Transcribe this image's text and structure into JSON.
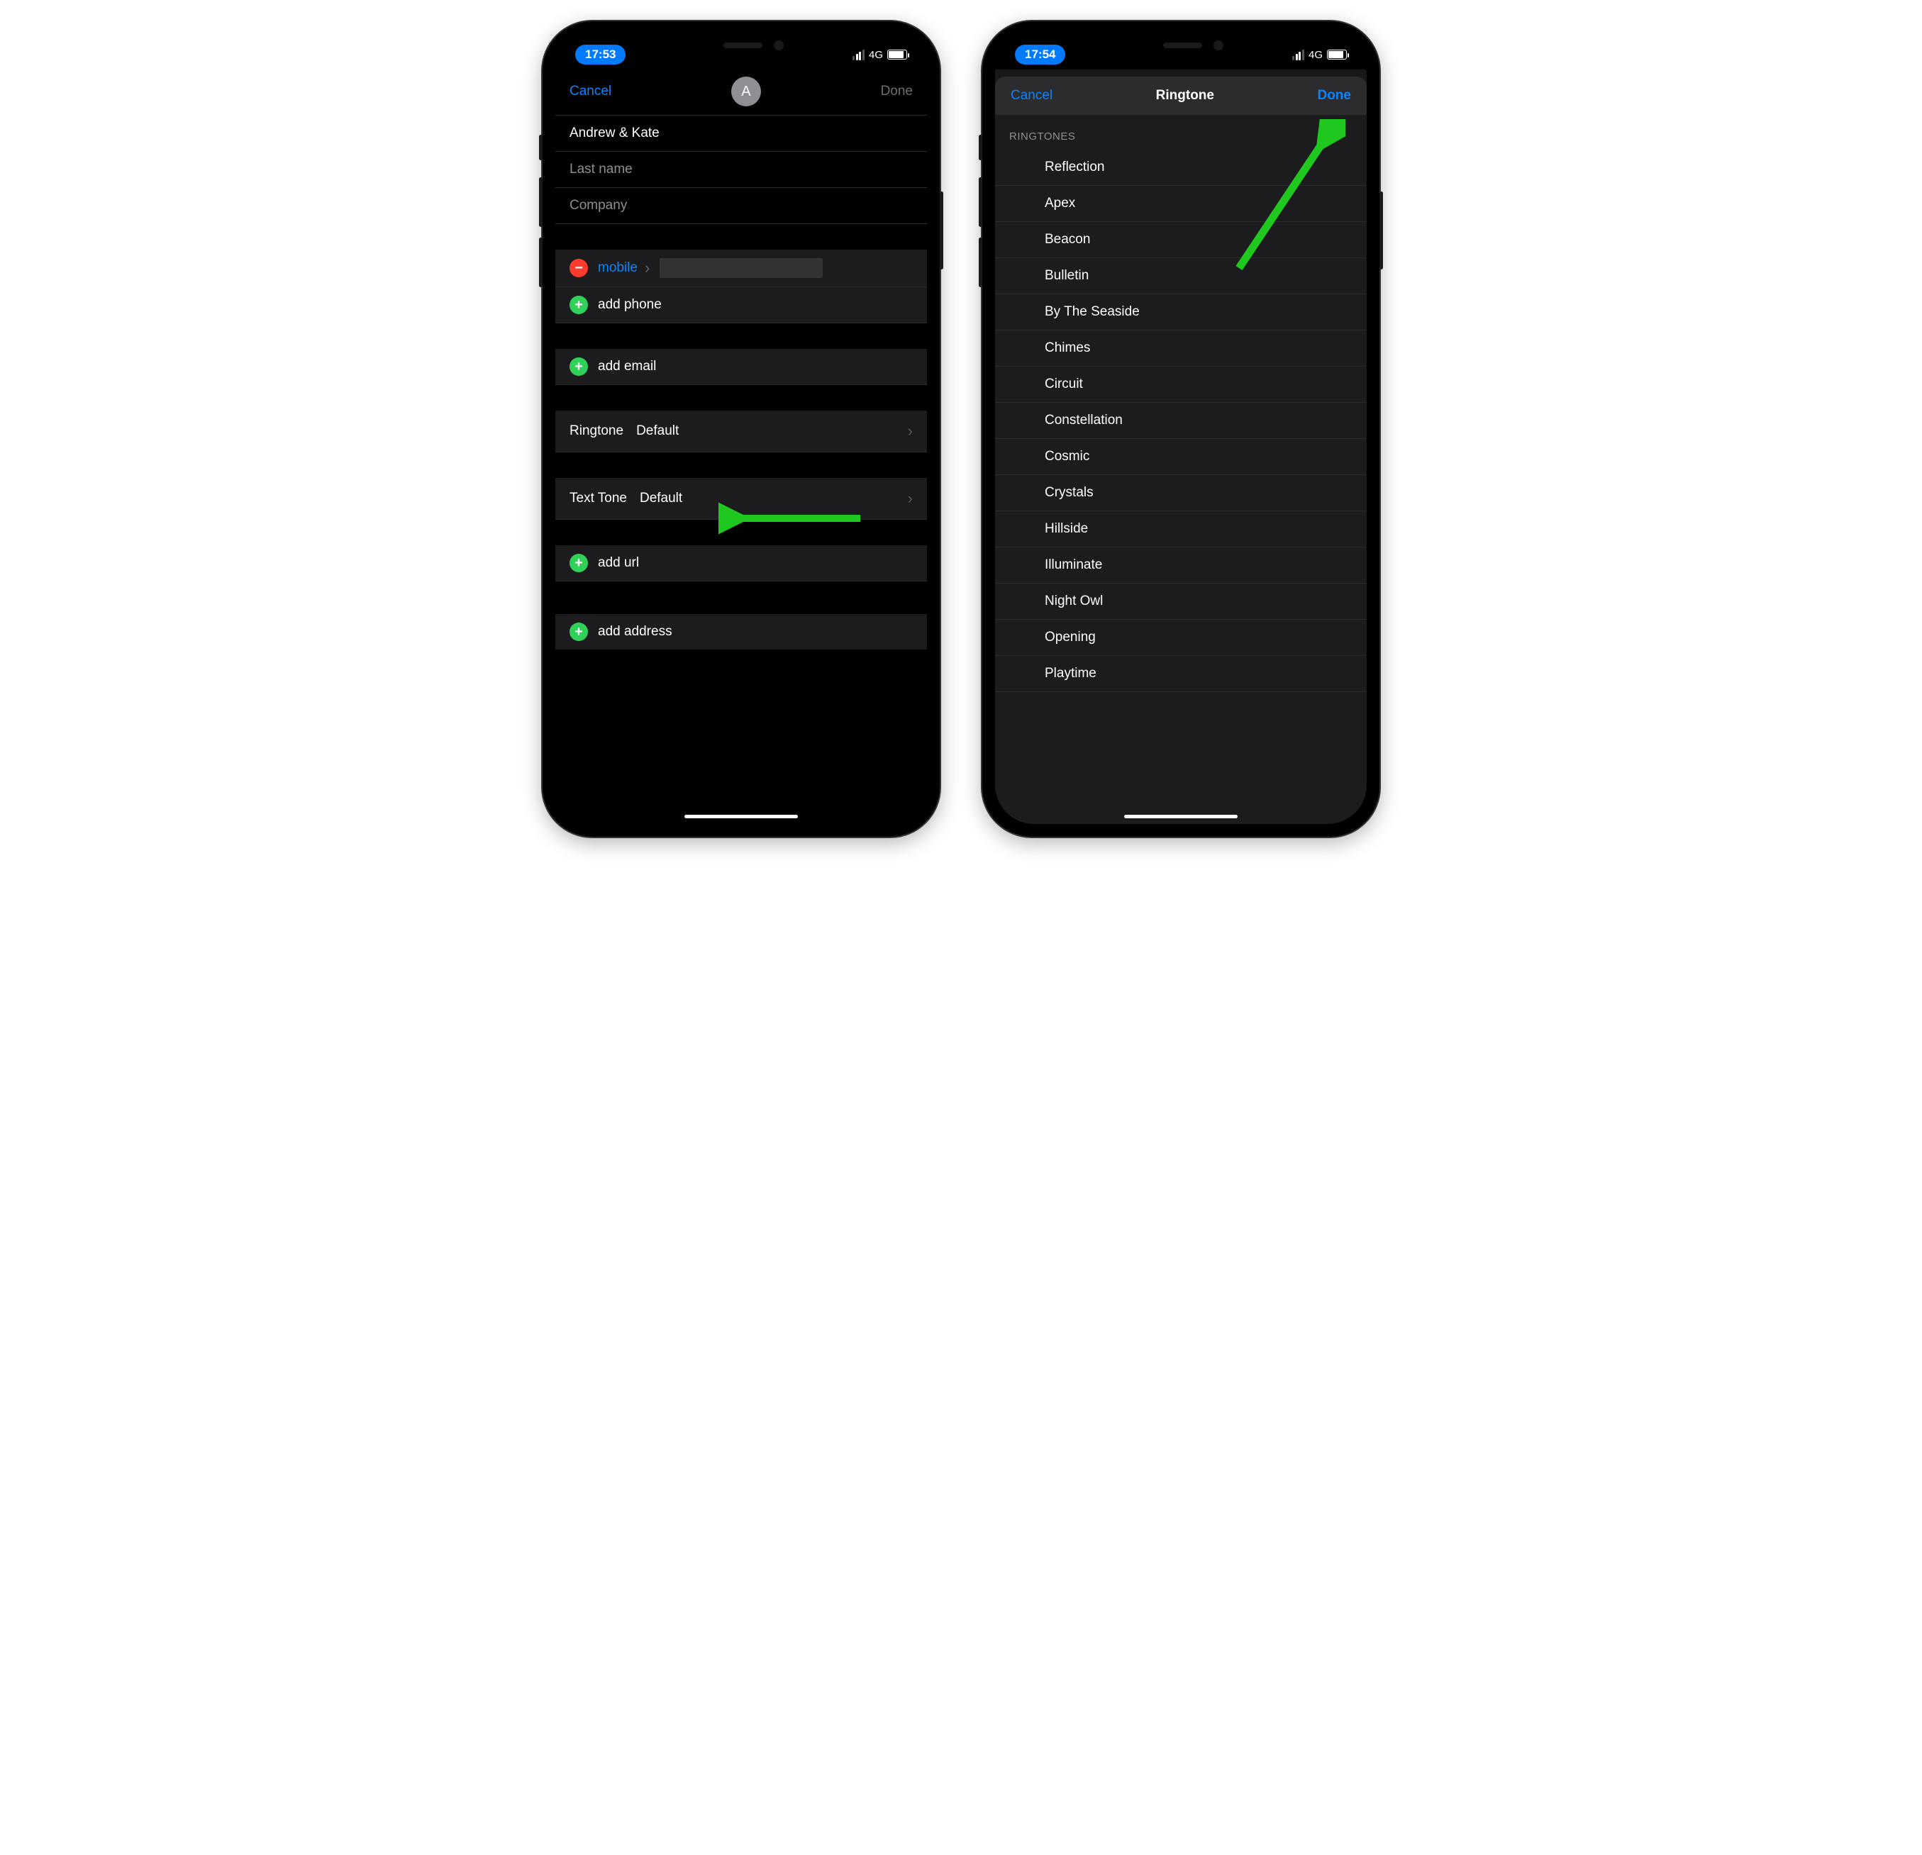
{
  "phone1": {
    "status": {
      "time": "17:53",
      "network": "4G"
    },
    "nav": {
      "cancel": "Cancel",
      "done": "Done",
      "avatar_letter": "A"
    },
    "name_field": "Andrew & Kate",
    "last_name_placeholder": "Last name",
    "company_placeholder": "Company",
    "mobile_label": "mobile",
    "add_phone": "add phone",
    "add_email": "add email",
    "ringtone_label": "Ringtone",
    "ringtone_value": "Default",
    "texttone_label": "Text Tone",
    "texttone_value": "Default",
    "add_url": "add url",
    "add_address": "add address"
  },
  "phone2": {
    "status": {
      "time": "17:54",
      "network": "4G"
    },
    "nav": {
      "cancel": "Cancel",
      "title": "Ringtone",
      "done": "Done"
    },
    "section_header": "RINGTONES",
    "ringtones": [
      "Reflection",
      "Apex",
      "Beacon",
      "Bulletin",
      "By The Seaside",
      "Chimes",
      "Circuit",
      "Constellation",
      "Cosmic",
      "Crystals",
      "Hillside",
      "Illuminate",
      "Night Owl",
      "Opening",
      "Playtime"
    ]
  }
}
